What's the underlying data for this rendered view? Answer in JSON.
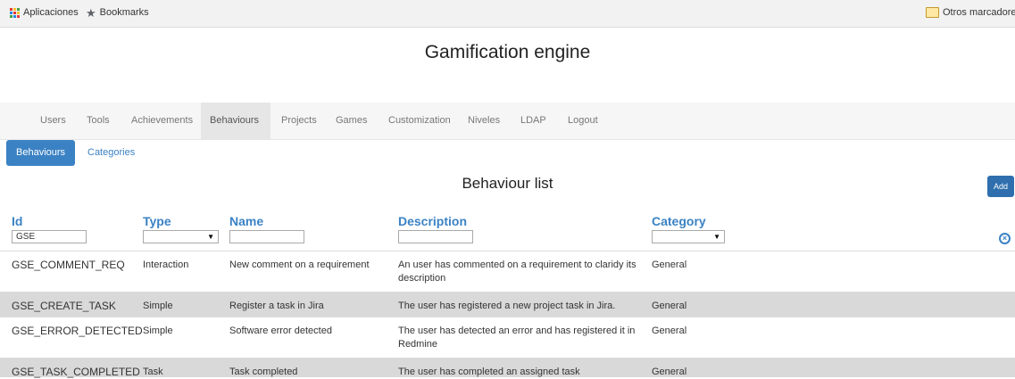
{
  "bookmarks": {
    "apps_label": "Aplicaciones",
    "bookmarks_label": "Bookmarks",
    "other_label": "Otros marcadores"
  },
  "app_title": "Gamification engine",
  "nav": {
    "items": [
      "Users",
      "Tools",
      "Achievements",
      "Behaviours",
      "Projects",
      "Games",
      "Customization",
      "Niveles",
      "LDAP",
      "Logout"
    ],
    "active": "Behaviours"
  },
  "subtabs": {
    "behaviours": "Behaviours",
    "categories": "Categories"
  },
  "list_title": "Behaviour list",
  "add_label": "Add",
  "columns": {
    "id": "Id",
    "type": "Type",
    "name": "Name",
    "description": "Description",
    "category": "Category"
  },
  "filters": {
    "id_value": "GSE",
    "type_value": "",
    "name_value": "",
    "description_value": "",
    "category_value": ""
  },
  "rows": [
    {
      "id": "GSE_COMMENT_REQ",
      "type": "Interaction",
      "name": "New comment on a requirement",
      "description": "An user has commented on a requirement to claridy its description",
      "category": "General"
    },
    {
      "id": "GSE_CREATE_TASK",
      "type": "Simple",
      "name": "Register a task in Jira",
      "description": "The user has registered a new project task in Jira.",
      "category": "General"
    },
    {
      "id": "GSE_ERROR_DETECTED",
      "type": "Simple",
      "name": "Software error detected",
      "description": "The user has detected an error and has registered it in Redmine",
      "category": "General"
    },
    {
      "id": "GSE_TASK_COMPLETED",
      "type": "Task",
      "name": "Task completed",
      "description": "The user has completed an assigned task",
      "category": "General"
    }
  ],
  "colors": {
    "accent": "#3b82c4",
    "add_button": "#2f6fad",
    "row_alt": "#d9d9d9"
  }
}
